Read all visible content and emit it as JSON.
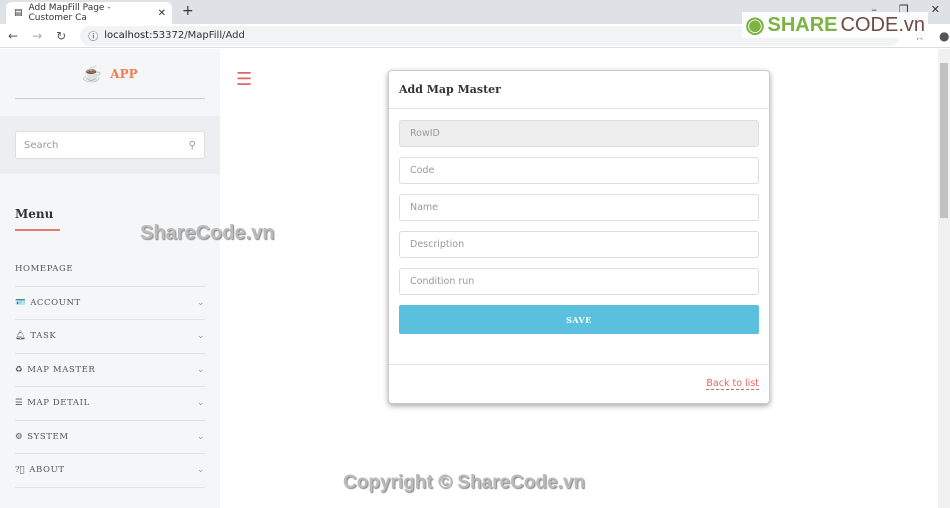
{
  "browser": {
    "tab_title": "Add MapFill Page - Customer Ca",
    "url_host": "localhost",
    "url_path": ":53372/MapFill/Add"
  },
  "brand": {
    "logo_text": "APP",
    "watermark_brand_a": "SHARE",
    "watermark_brand_b": "CODE.vn"
  },
  "sidebar": {
    "search_placeholder": "Search",
    "menu_title": "Menu",
    "items": [
      {
        "label": "HOMEPAGE",
        "icon": ""
      },
      {
        "label": "ACCOUNT",
        "icon": "id-card-icon"
      },
      {
        "label": "TASK",
        "icon": "bell-icon"
      },
      {
        "label": "MAP MASTER",
        "icon": "recycle-icon"
      },
      {
        "label": "MAP DETAIL",
        "icon": "signpost-icon"
      },
      {
        "label": "SYSTEM",
        "icon": "cogs-icon"
      },
      {
        "label": "ABOUT",
        "icon": "question-circle-icon"
      }
    ]
  },
  "form": {
    "title": "Add Map Master",
    "fields": {
      "rowid": "RowID",
      "code": "Code",
      "name": "Name",
      "description": "Description",
      "condition": "Condition run"
    },
    "save_label": "SAVE",
    "back_link": "Back to list"
  },
  "watermarks": {
    "center": "ShareCode.vn",
    "copyright": "Copyright © ShareCode.vn"
  },
  "colors": {
    "accent": "#f47b4f",
    "save": "#5bc0de",
    "link": "#e06666"
  }
}
